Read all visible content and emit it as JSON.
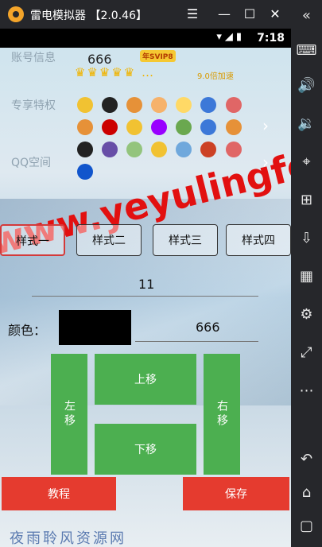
{
  "window": {
    "title": "雷电模拟器 【2.0.46】"
  },
  "status": {
    "time": "7:18"
  },
  "account": {
    "label": "账号信息",
    "value": "666",
    "badge": "年SVIP8",
    "speed": "9.0倍加速"
  },
  "privilege": {
    "label": "专享特权"
  },
  "qzone": {
    "label": "QQ空间"
  },
  "watermark": "www.yeyulingfeng.com",
  "tabs": [
    {
      "label": "样式一"
    },
    {
      "label": "样式二"
    },
    {
      "label": "样式三"
    },
    {
      "label": "样式四"
    }
  ],
  "number_field": {
    "value": "11"
  },
  "color": {
    "label": "颜色：",
    "swatch": "#000000",
    "value": "666"
  },
  "moves": {
    "up": "上移",
    "down": "下移",
    "left": "左移",
    "right": "右移"
  },
  "actions": {
    "tutorial": "教程",
    "save": "保存"
  },
  "footer": "夜雨聆风资源网",
  "colors": {
    "accent_green": "#4caf50",
    "accent_red": "#e53b2f"
  }
}
